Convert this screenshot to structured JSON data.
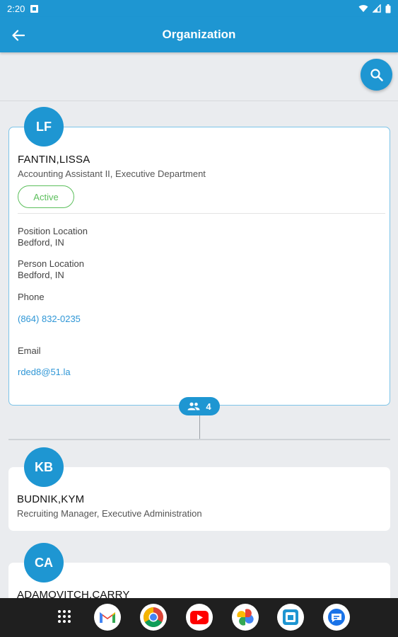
{
  "status_bar": {
    "time": "2:20"
  },
  "app_bar": {
    "title": "Organization"
  },
  "primary_person": {
    "initials": "LF",
    "name": "FANTIN,LISSA",
    "title": "Accounting Assistant II, Executive Department",
    "status": "Active",
    "position_location_label": "Position Location",
    "position_location": "Bedford, IN",
    "person_location_label": "Person Location",
    "person_location": "Bedford, IN",
    "phone_label": "Phone",
    "phone": "(864) 832-0235",
    "email_label": "Email",
    "email": "rded8@51.la",
    "direct_reports_count": "4"
  },
  "reports": [
    {
      "initials": "KB",
      "name": "BUDNIK,KYM",
      "title": "Recruiting Manager, Executive Administration"
    },
    {
      "initials": "CA",
      "name": "ADAMOVITCH,CARRY",
      "title": ""
    }
  ],
  "colors": {
    "primary": "#1e96d2",
    "active": "#5cbf5c",
    "link": "#2e96d6"
  },
  "dock": [
    "apps-grid-icon",
    "gmail-icon",
    "chrome-icon",
    "youtube-icon",
    "photos-icon",
    "app-icon",
    "messages-icon"
  ]
}
